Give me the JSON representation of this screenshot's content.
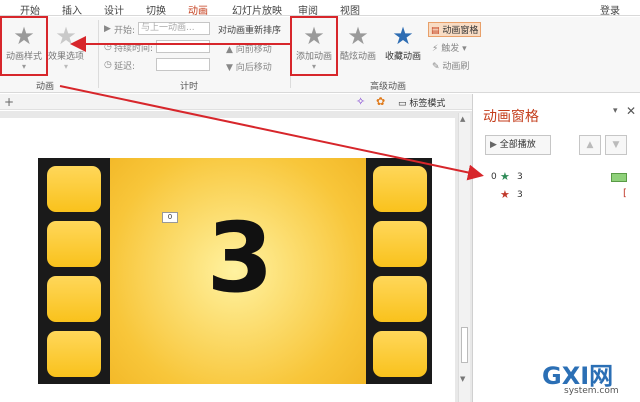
{
  "tabs": [
    "开始",
    "插入",
    "设计",
    "切换",
    "动画",
    "幻灯片放映",
    "审阅",
    "视图"
  ],
  "login": "登录",
  "ribbon": {
    "anim_style": "动画样式",
    "effect_options": "效果选项",
    "start_label": "开始:",
    "start_value": "与上一动画...",
    "duration_label": "持续时间:",
    "delay_label": "延迟:",
    "reorder_title": "对动画重新排序",
    "move_earlier": "向前移动",
    "move_later": "向后移动",
    "add_anim": "添加动画",
    "cool_anim": "酷炫动画",
    "fav_anim": "收藏动画",
    "anim_pane": "动画窗格",
    "trigger": "触发",
    "anim_painter": "动画刷",
    "group_anim": "动画",
    "group_timing": "计时",
    "group_adv": "高级动画"
  },
  "subbar": {
    "label_mode": "标签模式",
    "plus": "+"
  },
  "slide": {
    "number": "3",
    "tag": "0"
  },
  "pane": {
    "title": "动画窗格",
    "play_all": "全部播放",
    "items": [
      {
        "order": "0",
        "name": "3"
      },
      {
        "order": "",
        "name": "3"
      }
    ]
  },
  "watermark": {
    "brand": "GXI网",
    "site": "system.com"
  }
}
